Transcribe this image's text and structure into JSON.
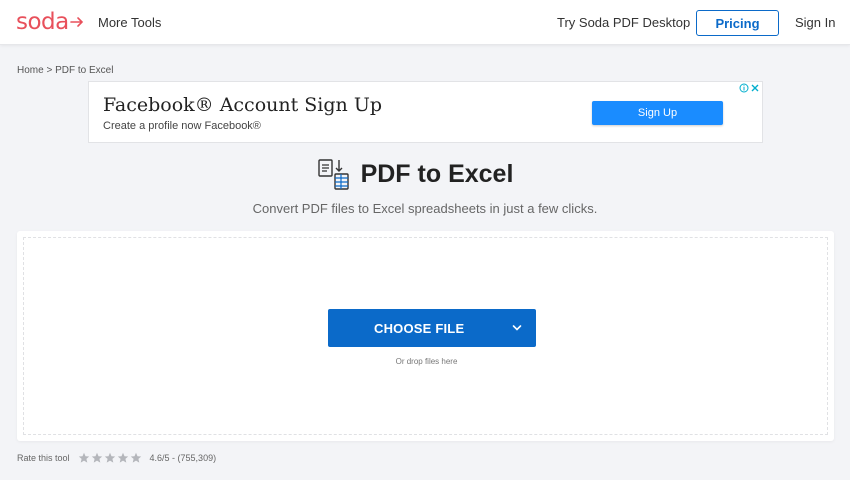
{
  "header": {
    "logo_text": "soda",
    "more_tools": "More Tools",
    "try_desktop": "Try Soda PDF Desktop",
    "pricing": "Pricing",
    "sign_in": "Sign In"
  },
  "breadcrumb": {
    "home": "Home",
    "separator": ">",
    "current": "PDF to Excel"
  },
  "ad": {
    "title": "Facebook® Account Sign Up",
    "subtitle": "Create a profile now Facebook®",
    "button": "Sign Up",
    "info_icon": "info-icon",
    "close_icon": "close-icon"
  },
  "tool": {
    "title": "PDF to Excel",
    "subtitle": "Convert PDF files to Excel spreadsheets in just a few clicks."
  },
  "upload": {
    "button": "CHOOSE FILE",
    "hint": "Or drop files here"
  },
  "rating": {
    "label": "Rate this tool",
    "stars": 5,
    "score": "4.6/5 - (755,309)"
  },
  "colors": {
    "brand": "#e8505b",
    "primary": "#0b6ac9",
    "ad_button": "#1a8cff",
    "star": "#b4b6bb"
  }
}
